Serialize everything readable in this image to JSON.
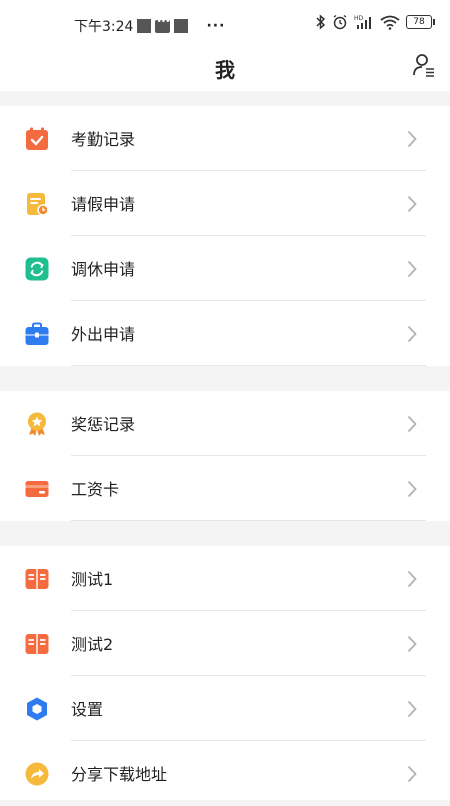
{
  "status_bar": {
    "time": "下午3:24",
    "more": "···",
    "battery": "78"
  },
  "header": {
    "title": "我"
  },
  "sections": [
    {
      "items": [
        {
          "label": "考勤记录",
          "icon": "calendar-check-icon"
        },
        {
          "label": "请假申请",
          "icon": "leave-document-icon"
        },
        {
          "label": "调休申请",
          "icon": "swap-refresh-icon"
        },
        {
          "label": "外出申请",
          "icon": "briefcase-icon"
        }
      ]
    },
    {
      "items": [
        {
          "label": "奖惩记录",
          "icon": "award-medal-icon"
        },
        {
          "label": "工资卡",
          "icon": "card-icon"
        }
      ]
    },
    {
      "items": [
        {
          "label": "测试1",
          "icon": "book-icon"
        },
        {
          "label": "测试2",
          "icon": "book-icon"
        },
        {
          "label": "设置",
          "icon": "hexagon-settings-icon"
        },
        {
          "label": "分享下载地址",
          "icon": "share-icon"
        }
      ]
    }
  ],
  "colors": {
    "orange": "#f36b3f",
    "yellow": "#f5b93b",
    "green": "#1fbf8f",
    "blue": "#2f7bf0",
    "gray_chevron": "#b3b3b3"
  }
}
